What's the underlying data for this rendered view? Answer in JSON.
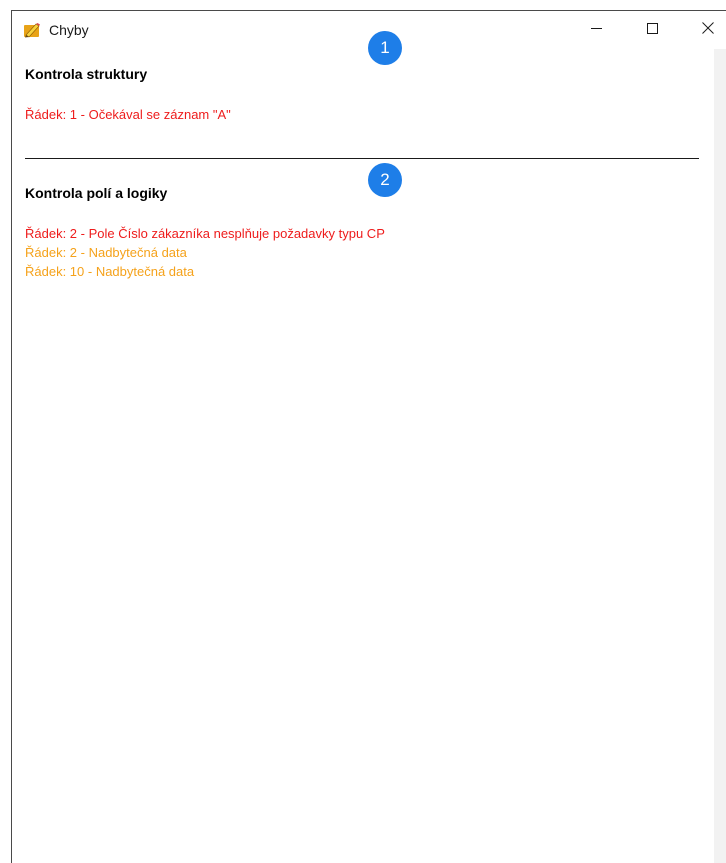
{
  "window": {
    "title": "Chyby",
    "icon": "pencil-icon",
    "controls": [
      "minimize-icon",
      "maximize-icon",
      "close-icon"
    ]
  },
  "sections": [
    {
      "badge": "1",
      "title": "Kontrola struktury",
      "messages": [
        {
          "text": "Řádek: 1 - Očekával se záznam \"A\"",
          "level": "error"
        }
      ]
    },
    {
      "badge": "2",
      "title": "Kontrola polí a logiky",
      "messages": [
        {
          "text": "Řádek: 2 - Pole Číslo zákazníka nesplňuje požadavky typu CP",
          "level": "error"
        },
        {
          "text": "Řádek: 2 - Nadbytečná data",
          "level": "warning"
        },
        {
          "text": "Řádek: 10 - Nadbytečná data",
          "level": "warning"
        }
      ]
    }
  ],
  "colors": {
    "error": "#ee1c1c",
    "warning": "#f5a21b",
    "badge": "#1e7ee8"
  }
}
